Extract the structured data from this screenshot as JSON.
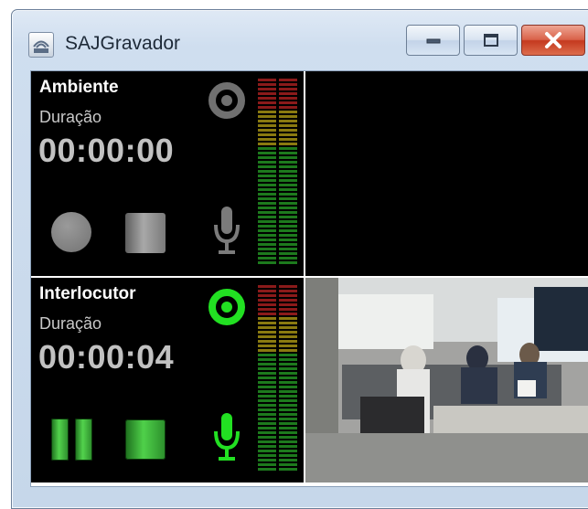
{
  "window": {
    "title": "SAJGravador",
    "controls": [
      "minimize",
      "maximize",
      "close"
    ]
  },
  "panels": [
    {
      "name": "Ambiente",
      "duration_label": "Duração",
      "duration": "00:00:00",
      "state": "idle",
      "accent_color": "#7a7a7a",
      "meter_level": 0.0,
      "buttons": [
        "record-button",
        "stop-button"
      ],
      "video": "black"
    },
    {
      "name": "Interlocutor",
      "duration_label": "Duração",
      "duration": "00:00:04",
      "state": "recording",
      "accent_color": "#22e022",
      "meter_level": 0.0,
      "buttons": [
        "pause-button",
        "stop-button"
      ],
      "video": "camera-feed-office"
    }
  ],
  "meter_colors": {
    "top": "#8b1a1a",
    "middle": "#8a7a10",
    "bottom": "#1d7a1d"
  }
}
